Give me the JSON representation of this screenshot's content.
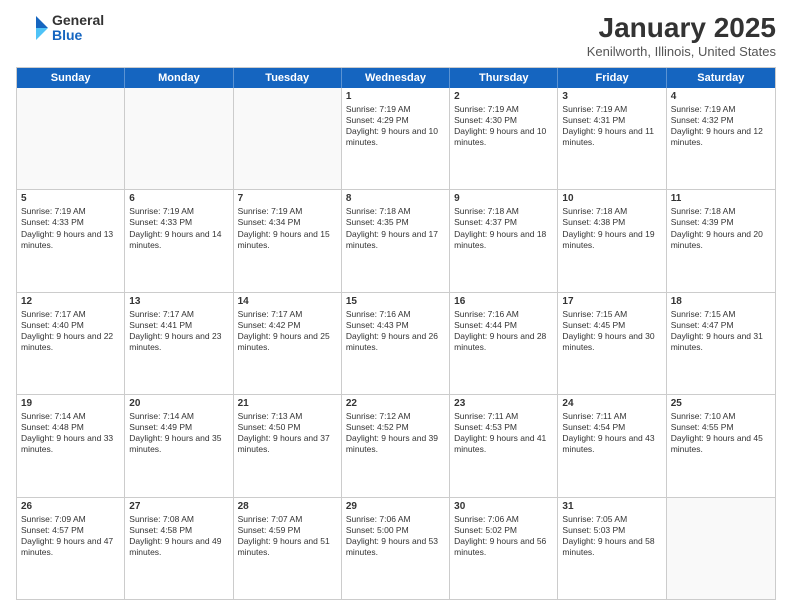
{
  "logo": {
    "general": "General",
    "blue": "Blue"
  },
  "title": "January 2025",
  "location": "Kenilworth, Illinois, United States",
  "days_of_week": [
    "Sunday",
    "Monday",
    "Tuesday",
    "Wednesday",
    "Thursday",
    "Friday",
    "Saturday"
  ],
  "weeks": [
    [
      {
        "day": "",
        "empty": true
      },
      {
        "day": "",
        "empty": true
      },
      {
        "day": "",
        "empty": true
      },
      {
        "day": "1",
        "sunrise": "7:19 AM",
        "sunset": "4:29 PM",
        "daylight": "9 hours and 10 minutes."
      },
      {
        "day": "2",
        "sunrise": "7:19 AM",
        "sunset": "4:30 PM",
        "daylight": "9 hours and 10 minutes."
      },
      {
        "day": "3",
        "sunrise": "7:19 AM",
        "sunset": "4:31 PM",
        "daylight": "9 hours and 11 minutes."
      },
      {
        "day": "4",
        "sunrise": "7:19 AM",
        "sunset": "4:32 PM",
        "daylight": "9 hours and 12 minutes."
      }
    ],
    [
      {
        "day": "5",
        "sunrise": "7:19 AM",
        "sunset": "4:33 PM",
        "daylight": "9 hours and 13 minutes."
      },
      {
        "day": "6",
        "sunrise": "7:19 AM",
        "sunset": "4:33 PM",
        "daylight": "9 hours and 14 minutes."
      },
      {
        "day": "7",
        "sunrise": "7:19 AM",
        "sunset": "4:34 PM",
        "daylight": "9 hours and 15 minutes."
      },
      {
        "day": "8",
        "sunrise": "7:18 AM",
        "sunset": "4:35 PM",
        "daylight": "9 hours and 17 minutes."
      },
      {
        "day": "9",
        "sunrise": "7:18 AM",
        "sunset": "4:37 PM",
        "daylight": "9 hours and 18 minutes."
      },
      {
        "day": "10",
        "sunrise": "7:18 AM",
        "sunset": "4:38 PM",
        "daylight": "9 hours and 19 minutes."
      },
      {
        "day": "11",
        "sunrise": "7:18 AM",
        "sunset": "4:39 PM",
        "daylight": "9 hours and 20 minutes."
      }
    ],
    [
      {
        "day": "12",
        "sunrise": "7:17 AM",
        "sunset": "4:40 PM",
        "daylight": "9 hours and 22 minutes."
      },
      {
        "day": "13",
        "sunrise": "7:17 AM",
        "sunset": "4:41 PM",
        "daylight": "9 hours and 23 minutes."
      },
      {
        "day": "14",
        "sunrise": "7:17 AM",
        "sunset": "4:42 PM",
        "daylight": "9 hours and 25 minutes."
      },
      {
        "day": "15",
        "sunrise": "7:16 AM",
        "sunset": "4:43 PM",
        "daylight": "9 hours and 26 minutes."
      },
      {
        "day": "16",
        "sunrise": "7:16 AM",
        "sunset": "4:44 PM",
        "daylight": "9 hours and 28 minutes."
      },
      {
        "day": "17",
        "sunrise": "7:15 AM",
        "sunset": "4:45 PM",
        "daylight": "9 hours and 30 minutes."
      },
      {
        "day": "18",
        "sunrise": "7:15 AM",
        "sunset": "4:47 PM",
        "daylight": "9 hours and 31 minutes."
      }
    ],
    [
      {
        "day": "19",
        "sunrise": "7:14 AM",
        "sunset": "4:48 PM",
        "daylight": "9 hours and 33 minutes."
      },
      {
        "day": "20",
        "sunrise": "7:14 AM",
        "sunset": "4:49 PM",
        "daylight": "9 hours and 35 minutes."
      },
      {
        "day": "21",
        "sunrise": "7:13 AM",
        "sunset": "4:50 PM",
        "daylight": "9 hours and 37 minutes."
      },
      {
        "day": "22",
        "sunrise": "7:12 AM",
        "sunset": "4:52 PM",
        "daylight": "9 hours and 39 minutes."
      },
      {
        "day": "23",
        "sunrise": "7:11 AM",
        "sunset": "4:53 PM",
        "daylight": "9 hours and 41 minutes."
      },
      {
        "day": "24",
        "sunrise": "7:11 AM",
        "sunset": "4:54 PM",
        "daylight": "9 hours and 43 minutes."
      },
      {
        "day": "25",
        "sunrise": "7:10 AM",
        "sunset": "4:55 PM",
        "daylight": "9 hours and 45 minutes."
      }
    ],
    [
      {
        "day": "26",
        "sunrise": "7:09 AM",
        "sunset": "4:57 PM",
        "daylight": "9 hours and 47 minutes."
      },
      {
        "day": "27",
        "sunrise": "7:08 AM",
        "sunset": "4:58 PM",
        "daylight": "9 hours and 49 minutes."
      },
      {
        "day": "28",
        "sunrise": "7:07 AM",
        "sunset": "4:59 PM",
        "daylight": "9 hours and 51 minutes."
      },
      {
        "day": "29",
        "sunrise": "7:06 AM",
        "sunset": "5:00 PM",
        "daylight": "9 hours and 53 minutes."
      },
      {
        "day": "30",
        "sunrise": "7:06 AM",
        "sunset": "5:02 PM",
        "daylight": "9 hours and 56 minutes."
      },
      {
        "day": "31",
        "sunrise": "7:05 AM",
        "sunset": "5:03 PM",
        "daylight": "9 hours and 58 minutes."
      },
      {
        "day": "",
        "empty": true
      }
    ]
  ]
}
